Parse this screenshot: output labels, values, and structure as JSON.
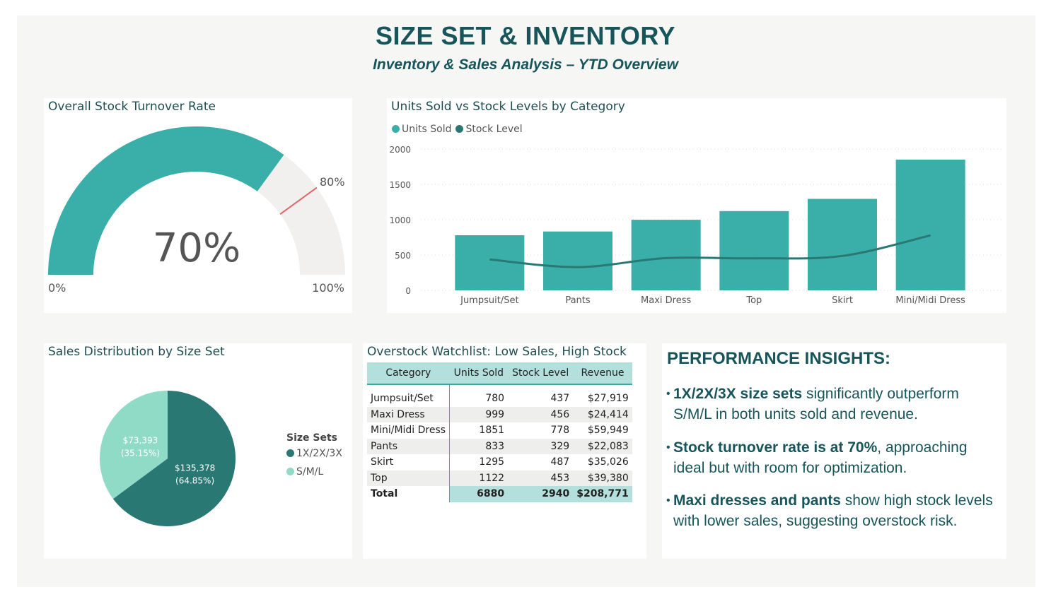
{
  "header": {
    "title": "SIZE SET & INVENTORY",
    "subtitle": "Inventory & Sales Analysis – YTD Overview"
  },
  "colors": {
    "teal": "#3aafa9",
    "dark_teal": "#2a7873",
    "light_teal": "#8fdbc6",
    "header_text": "#17555a"
  },
  "gauge": {
    "title": "Overall Stock Turnover Rate",
    "value_label": "70%",
    "min_label": "0%",
    "max_label": "100%",
    "target_label": "80%",
    "value": 0.7,
    "target": 0.8
  },
  "chart_data": [
    {
      "type": "bar",
      "title": "Units Sold vs Stock Levels by Category",
      "categories": [
        "Jumpsuit/Set",
        "Pants",
        "Maxi Dress",
        "Top",
        "Skirt",
        "Mini/Midi Dress"
      ],
      "series": [
        {
          "name": "Units Sold",
          "type": "bar",
          "values": [
            780,
            833,
            999,
            1122,
            1295,
            1851
          ]
        },
        {
          "name": "Stock Level",
          "type": "line",
          "values": [
            437,
            329,
            456,
            453,
            487,
            778
          ]
        }
      ],
      "yticks": [
        "0",
        "500",
        "1000",
        "1500",
        "2000"
      ],
      "ylim": [
        0,
        2000
      ],
      "grid": true,
      "legend": "top-left"
    },
    {
      "type": "pie",
      "title": "Sales Distribution by Size Set",
      "legend_title": "Size Sets",
      "slices": [
        {
          "name": "1X/2X/3X",
          "value": 135378,
          "value_label": "$135,378",
          "pct_label": "(64.85%)"
        },
        {
          "name": "S/M/L",
          "value": 73393,
          "value_label": "$73,393",
          "pct_label": "(35.15%)"
        }
      ],
      "legend": "right"
    }
  ],
  "watchlist": {
    "title": "Overstock Watchlist: Low Sales, High Stock",
    "headers": [
      "Category",
      "Units Sold",
      "Stock Level",
      "Revenue"
    ],
    "rows": [
      [
        "Jumpsuit/Set",
        "780",
        "437",
        "$27,919"
      ],
      [
        "Maxi Dress",
        "999",
        "456",
        "$24,414"
      ],
      [
        "Mini/Midi Dress",
        "1851",
        "778",
        "$59,949"
      ],
      [
        "Pants",
        "833",
        "329",
        "$22,083"
      ],
      [
        "Skirt",
        "1295",
        "487",
        "$35,026"
      ],
      [
        "Top",
        "1122",
        "453",
        "$39,380"
      ]
    ],
    "total": [
      "Total",
      "6880",
      "2940",
      "$208,771"
    ]
  },
  "insights": {
    "title": "PERFORMANCE INSIGHTS:",
    "items": [
      {
        "bold": "1X/2X/3X size sets",
        "rest": " significantly outperform S/M/L in both units sold and revenue."
      },
      {
        "bold": "Stock turnover rate is at 70%",
        "rest": ", approaching ideal but with room for optimization."
      },
      {
        "bold": "Maxi dresses and pants",
        "rest": " show high stock levels with lower sales, suggesting overstock risk."
      }
    ]
  }
}
